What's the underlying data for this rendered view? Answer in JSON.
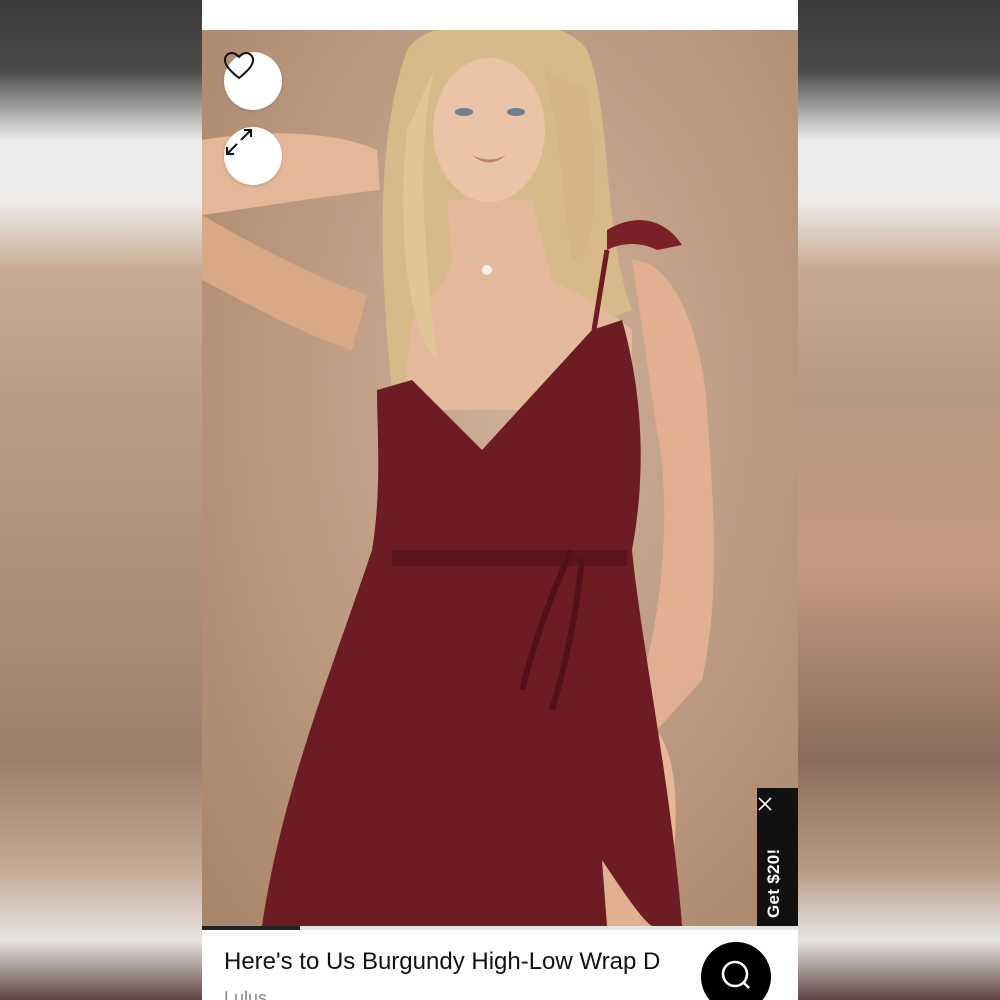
{
  "product": {
    "title": "Here's to Us Burgundy High-Low Wrap D",
    "brand": "Lulus"
  },
  "gallery": {
    "progress_fraction": 0.165
  },
  "promo": {
    "label": "Get $20!"
  },
  "icons": {
    "favorite": "heart-icon",
    "expand": "expand-icon",
    "close": "close-icon",
    "chat": "chat-icon"
  },
  "colors": {
    "dress": "#6e1c24",
    "background_photo": "#bf9d84",
    "promo_bg": "#111111"
  }
}
